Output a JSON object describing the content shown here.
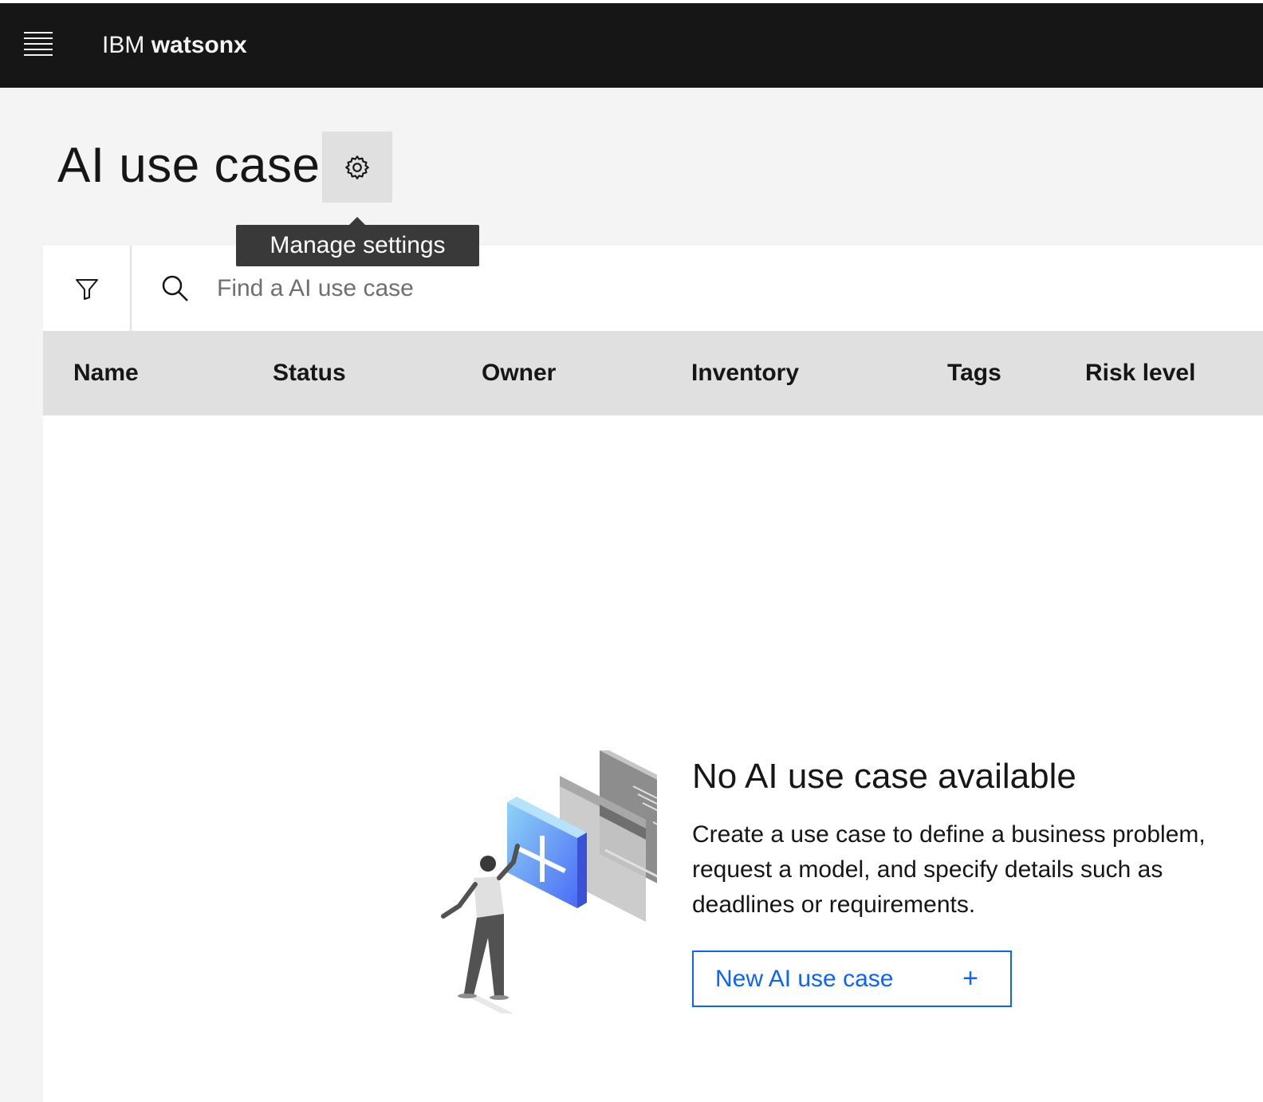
{
  "header": {
    "brand_prefix": "IBM",
    "brand_name": "watsonx"
  },
  "page": {
    "title": "AI use case",
    "settings_tooltip": "Manage settings"
  },
  "search": {
    "placeholder": "Find a AI use case"
  },
  "table": {
    "columns": [
      "Name",
      "Status",
      "Owner",
      "Inventory",
      "Tags",
      "Risk level"
    ]
  },
  "empty_state": {
    "title": "No AI use case available",
    "description": "Create a use case to define a business problem, request a model, and specify details such as deadlines or requirements.",
    "button_label": "New AI use case",
    "button_icon": "+"
  },
  "colors": {
    "header_bg": "#161616",
    "accent": "#0f62fe",
    "table_header_bg": "#e0e0e0"
  }
}
